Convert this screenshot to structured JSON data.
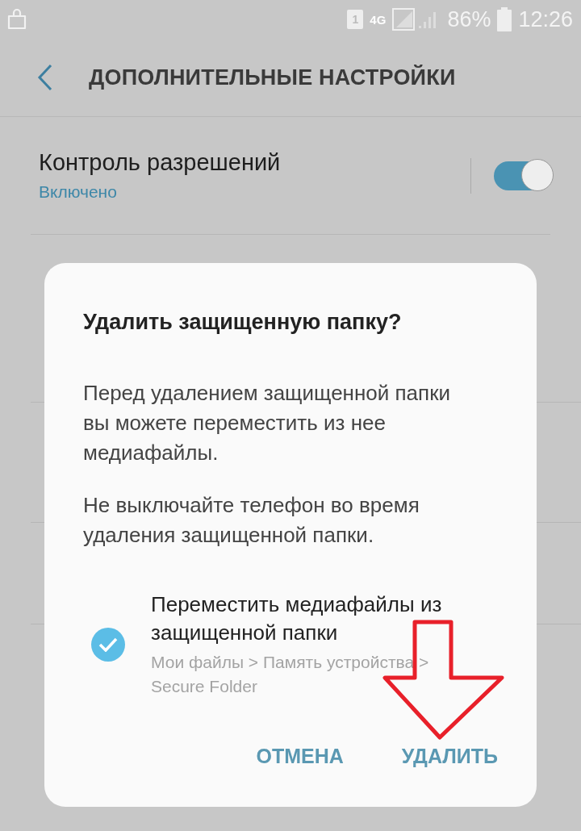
{
  "status_bar": {
    "sim_slot": "1",
    "network": "4G",
    "battery": "86%",
    "time": "12:26"
  },
  "header": {
    "title": "ДОПОЛНИТЕЛЬНЫЕ НАСТРОЙКИ"
  },
  "settings": [
    {
      "title": "Контроль разрешений",
      "subtitle": "Включено",
      "on": true
    }
  ],
  "dialog": {
    "title": "Удалить защищенную папку?",
    "paragraphs": [
      "Перед удалением защищенной папки вы можете переместить из нее медиафайлы.",
      "Не выключайте телефон во время удаления защищенной папки."
    ],
    "option": {
      "label": "Переместить медиафайлы из защищенной папки",
      "path": "Мои файлы > Память устройства > Secure Folder",
      "checked": true
    },
    "buttons": [
      {
        "label": "ОТМЕНА"
      },
      {
        "label": "УДАЛИТЬ"
      }
    ]
  }
}
